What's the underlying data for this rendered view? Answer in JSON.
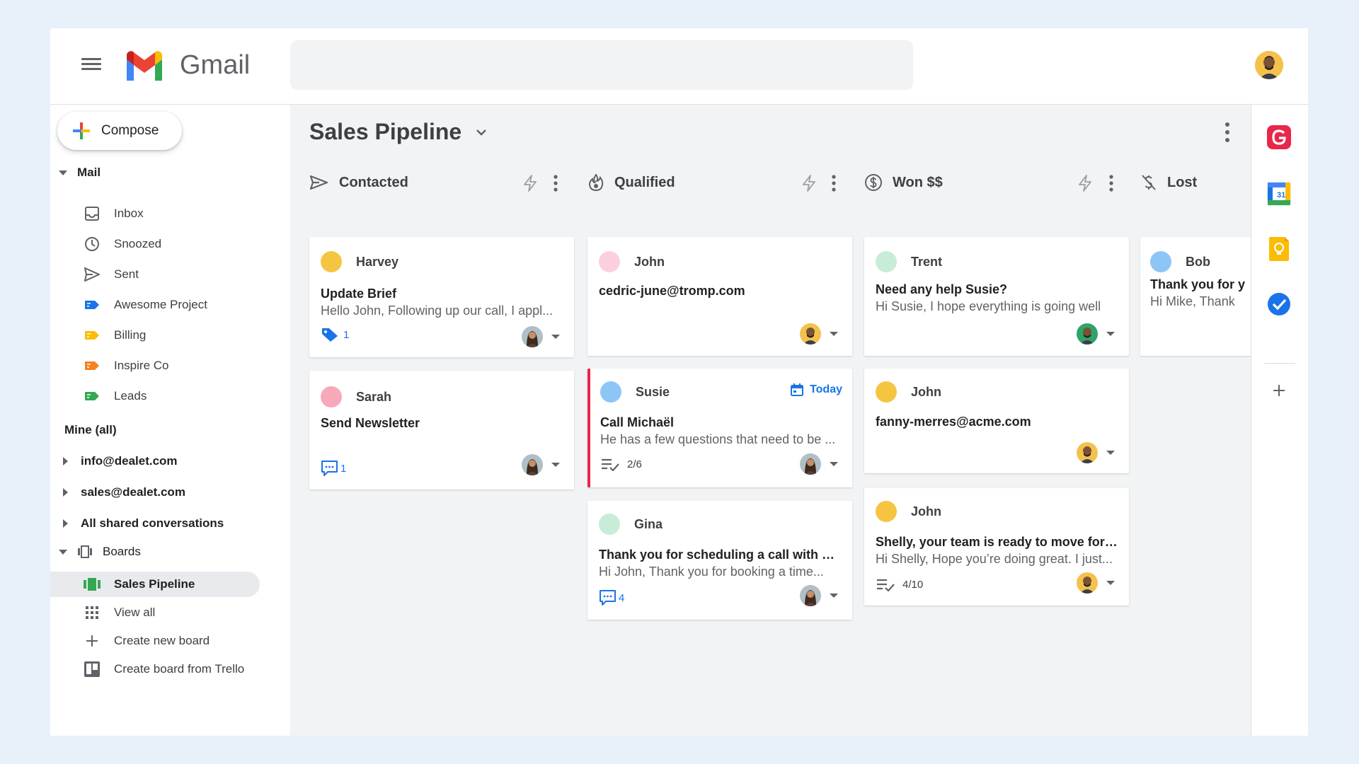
{
  "app": {
    "brand": "Gmail"
  },
  "search": {
    "placeholder": ""
  },
  "compose": {
    "label": "Compose"
  },
  "sidebar": {
    "mail_header": "Mail",
    "mail_items": [
      {
        "label": "Inbox",
        "icon": "inbox-icon"
      },
      {
        "label": "Snoozed",
        "icon": "clock-icon"
      },
      {
        "label": "Sent",
        "icon": "send-icon"
      },
      {
        "label": "Awesome Project",
        "icon": "label-icon",
        "color": "#1a73e8"
      },
      {
        "label": "Billing",
        "icon": "label-icon",
        "color": "#fbbc04"
      },
      {
        "label": "Inspire Co",
        "icon": "label-icon",
        "color": "#f4821f"
      },
      {
        "label": "Leads",
        "icon": "label-icon",
        "color": "#34a853"
      }
    ],
    "mine_header": "Mine (all)",
    "shared": [
      "info@dealet.com",
      "sales@dealet.com",
      "All shared conversations"
    ],
    "boards_header": "Boards",
    "board_items": [
      {
        "label": "Sales Pipeline",
        "icon": "board-icon",
        "active": true
      },
      {
        "label": "View all",
        "icon": "grid-icon"
      },
      {
        "label": "Create new board",
        "icon": "plus-icon"
      },
      {
        "label": "Create board from Trello",
        "icon": "trello-icon"
      }
    ]
  },
  "board": {
    "title": "Sales Pipeline",
    "columns": [
      {
        "name": "Contacted",
        "icon": "send-icon",
        "cards": [
          {
            "name": "Harvey",
            "dot": "#f5c542",
            "subject": "Update Brief",
            "snippet": "Hello John, Following up our call, I appl...",
            "meta_icon": "tag-icon",
            "meta_count": "1"
          },
          {
            "name": "Sarah",
            "dot": "#f7a9b9",
            "subject": "Send Newsletter",
            "meta_icon": "comment-icon",
            "meta_count": "1"
          }
        ]
      },
      {
        "name": "Qualified",
        "icon": "flame-icon",
        "cards": [
          {
            "name": "John",
            "dot": "#fbd0dc",
            "subject": "cedric-june@tromp.com"
          },
          {
            "name": "Susie",
            "dot": "#8ec5f7",
            "subject": "Call Michaël",
            "snippet": "He has a few questions that need to be ...",
            "meta_icon": "checklist-icon",
            "meta_count": "2/6",
            "due": "Today"
          },
          {
            "name": "Gina",
            "dot": "#c9ecd8",
            "subject": "Thank you for scheduling a call with m...",
            "snippet": "Hi John, Thank you for booking a time...",
            "meta_icon": "comment-icon",
            "meta_count": "4"
          }
        ]
      },
      {
        "name": "Won $$",
        "icon": "dollar-icon",
        "cards": [
          {
            "name": "Trent",
            "dot": "#c9ecd8",
            "subject": "Need any help Susie?",
            "snippet": "Hi Susie, I hope everything is going well"
          },
          {
            "name": "John",
            "dot": "#f5c542",
            "subject": "fanny-merres@acme.com"
          },
          {
            "name": "John",
            "dot": "#f5c542",
            "subject": "Shelly, your team is ready to move forw...",
            "snippet": "Hi Shelly, Hope you’re doing great. I just...",
            "meta_icon": "checklist-icon",
            "meta_count": "4/10"
          }
        ]
      },
      {
        "name": "Lost",
        "icon": "money-off-icon",
        "cards": [
          {
            "name": "Bob",
            "dot": "#8ec5f7",
            "subject": "Thank you for y",
            "snippet": "Hi Mike, Thank"
          }
        ]
      }
    ]
  },
  "colors": {
    "accent": "#1a73e8",
    "flag": "#e8274b",
    "board_bg": "#f1f3f4"
  }
}
